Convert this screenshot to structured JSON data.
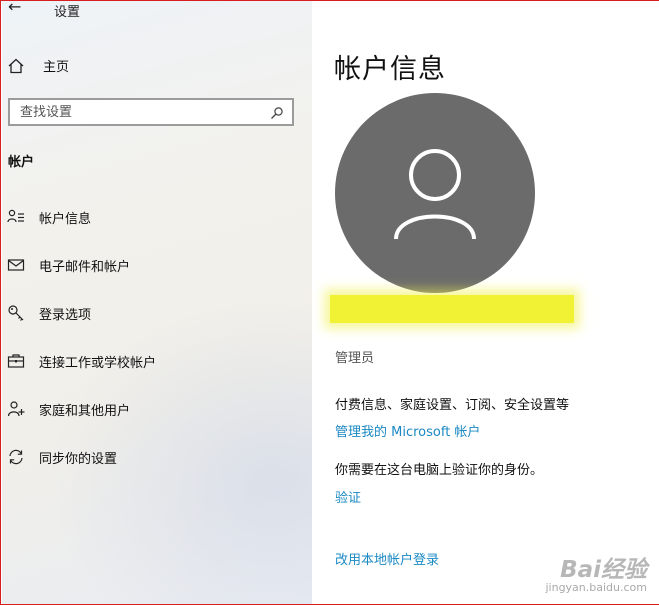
{
  "window": {
    "title": "设置"
  },
  "sidebar": {
    "home_label": "主页",
    "search_placeholder": "查找设置",
    "section_title": "帐户",
    "items": [
      {
        "label": "帐户信息",
        "icon": "account-info-icon"
      },
      {
        "label": "电子邮件和帐户",
        "icon": "mail-icon"
      },
      {
        "label": "登录选项",
        "icon": "key-icon"
      },
      {
        "label": "连接工作或学校帐户",
        "icon": "briefcase-icon"
      },
      {
        "label": "家庭和其他用户",
        "icon": "add-person-icon"
      },
      {
        "label": "同步你的设置",
        "icon": "sync-icon"
      }
    ]
  },
  "main": {
    "title": "帐户信息",
    "role": "管理员",
    "billing_text": "付费信息、家庭设置、订阅、安全设置等",
    "manage_link": "管理我的 Microsoft 帐户",
    "verify_prompt": "你需要在这台电脑上验证你的身份。",
    "verify_link": "验证",
    "local_login_link": "改用本地帐户登录"
  },
  "watermark": {
    "brand": "Bai经验",
    "url": "jingyan.baidu.com"
  },
  "colors": {
    "link": "#1b89c4",
    "avatar_bg": "#6b6b6b",
    "redaction": "#f1f233",
    "frame_border": "#d81e1e"
  }
}
